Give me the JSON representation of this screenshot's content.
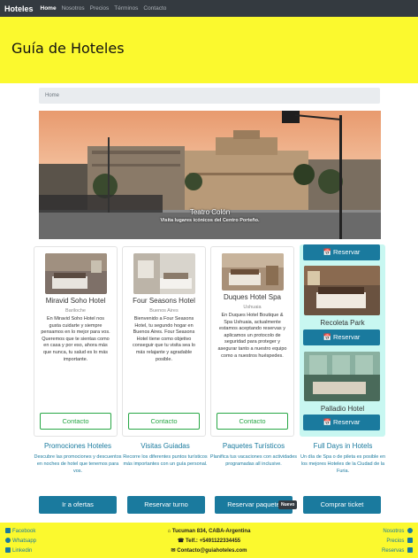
{
  "navbar": {
    "brand": "Hoteles",
    "links": [
      "Home",
      "Nosotros",
      "Precios",
      "Términos",
      "Contacto"
    ]
  },
  "header": {
    "title": "Guía de Hoteles"
  },
  "breadcrumb": {
    "current": "Home"
  },
  "hero": {
    "title": "Teatro Colón",
    "subtitle": "Visita lugares icónicos del Centro Porteño."
  },
  "cards": [
    {
      "name": "Miravid Soho Hotel",
      "city": "Bariloche",
      "description": "En Miravid Soho Hotel nos gusta cuidarte y siempre pensamos en lo mejor para vos. Queremos que te sientas como en casa y por eso, ahora más que nunca, tu salud es lo más importante.",
      "button": "Contacto"
    },
    {
      "name": "Four Seasons Hotel",
      "city": "Buenos Aires",
      "description": "Bienvenido a Four Seasons Hotel, tu segundo hogar en Buenos Aires. Four Seasons Hotel tiene como objetivo conseguir que tu visita sea lo más relajante y agradable posible.",
      "button": "Contacto"
    },
    {
      "name": "Duques Hotel Spa",
      "city": "Ushuaia",
      "description": "En Duques Hotel Boutique & Spa Ushuaia, actualmente estamos aceptando reservas y aplicamos un protocolo de seguridad para proteger y asegurar tanto a nuestro equipo como a nuestros huéspedes.",
      "button": "Contacto"
    }
  ],
  "booking": {
    "button_label": "Reservar",
    "hotels": [
      "Recoleta Park",
      "Palladio Hotel"
    ]
  },
  "promos": [
    {
      "title": "Promociones Hoteles",
      "description": "Descubre las promociones y descuentos en noches de hotel que tenemos para vos.",
      "button": "Ir a ofertas"
    },
    {
      "title": "Visitas Guiadas",
      "description": "Recorre los diferentes puntos turísticos más importantes con un guía personal.",
      "button": "Reservar turno"
    },
    {
      "title": "Paquetes Turísticos",
      "description": "Planifica tus vacaciones con actividades programadas all inclusive.",
      "button": "Reservar paquete",
      "badge": "Nuevo"
    },
    {
      "title": "Full Days in Hotels",
      "description": "Un día de Spa o de pileta es posible en los mejores Hoteles de la Ciudad de la Furia.",
      "button": "Comprar ticket"
    }
  ],
  "footer": {
    "social": [
      "Facebook",
      "Whatsapp",
      "Linkedin"
    ],
    "address": "Tucuman 834, CABA-Argentina",
    "phone": "Telf.: +5491122334455",
    "email": "Contacto@guiahoteles.com",
    "links": [
      "Nosotros",
      "Precios",
      "Reservas"
    ]
  },
  "colors": {
    "accent": "#1a7a9e",
    "header_bg": "#fbf92e",
    "navbar_bg": "#343a40",
    "contact_green": "#28a745",
    "booking_bg": "#c8f7f1"
  },
  "icons": [
    "calendar-icon",
    "facebook-icon",
    "whatsapp-icon",
    "linkedin-icon",
    "home-icon",
    "phone-icon",
    "envelope-icon",
    "globe-icon"
  ]
}
